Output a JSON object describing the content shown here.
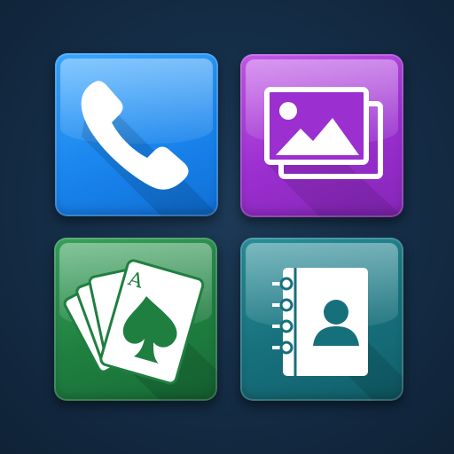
{
  "tiles": [
    {
      "id": "phone",
      "icon": "phone-icon",
      "color": "#1a86ee"
    },
    {
      "id": "gallery",
      "icon": "gallery-icon",
      "color": "#9b2fcf"
    },
    {
      "id": "cards",
      "icon": "playing-cards-icon",
      "color": "#1f7f40",
      "card_rank": "A"
    },
    {
      "id": "contacts",
      "icon": "contacts-book-icon",
      "color": "#16707c"
    }
  ],
  "background_color": "#142c45"
}
